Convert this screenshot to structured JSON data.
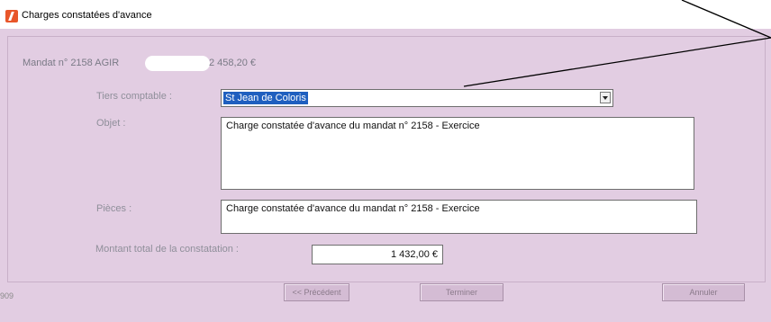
{
  "window": {
    "title": "Charges constatées d'avance",
    "icon": "app-logo-icon"
  },
  "header": {
    "mandat_label": "Mandat n° 2158   AGIR",
    "amount": "2 458,20 €"
  },
  "form": {
    "tiers_label": "Tiers comptable :",
    "tiers_value": "St Jean de Coloris",
    "objet_label": "Objet :",
    "objet_value": "Charge constatée d'avance du mandat n° 2158 - Exercice",
    "pieces_label": "Pièces :",
    "pieces_value": "Charge constatée d'avance du mandat n° 2158 - Exercice",
    "montant_label": "Montant total de la constatation :",
    "montant_value": "1 432,00 €"
  },
  "footer": {
    "code": "909",
    "prev_label": "<< Précédent",
    "finish_label": "Terminer",
    "cancel_label": "Annuler"
  },
  "annotation": {
    "color": "#000000"
  }
}
